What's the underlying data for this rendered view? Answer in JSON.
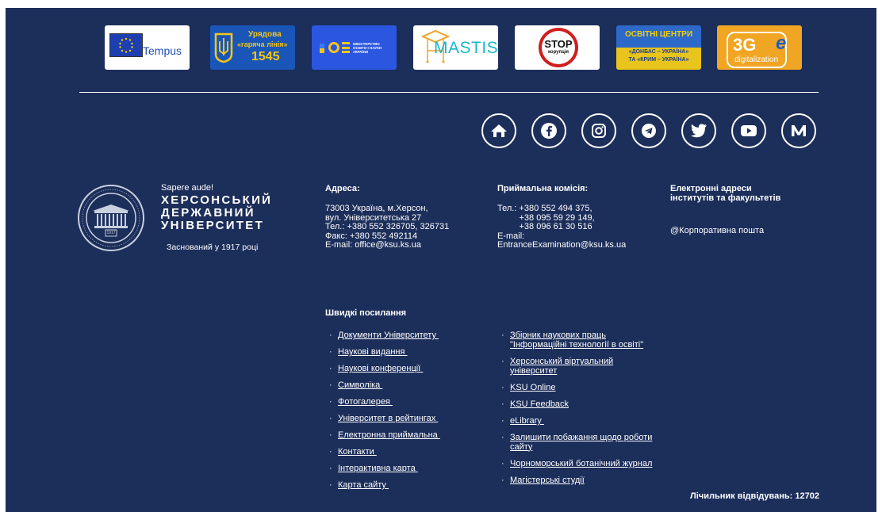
{
  "partners": [
    {
      "name": "tempus-logo",
      "text": "Tempus"
    },
    {
      "name": "hotline-logo",
      "line1": "Урядова",
      "line2": "«гаряча лінія»",
      "line3": "1545"
    },
    {
      "name": "ministry-logo",
      "text": "МІНІСТЕРСТВО ОСВІТИ І НАУКИ УКРАЇНИ"
    },
    {
      "name": "mastis-logo",
      "text": "MASTIS"
    },
    {
      "name": "stop-corruption-logo",
      "text": "STOP",
      "sub": "корупція"
    },
    {
      "name": "education-centers-logo",
      "line1": "ОСВІТНІ ЦЕНТРИ",
      "line2": "«ДОНБАС – УКРАЇНА»",
      "line3": "ТА «КРИМ – УКРАЇНА»"
    },
    {
      "name": "3g-digitalization-logo",
      "big": "3G",
      "small": "digitalization",
      "letter": "e"
    }
  ],
  "socials": [
    "home-icon",
    "facebook-icon",
    "instagram-icon",
    "telegram-icon",
    "twitter-icon",
    "youtube-icon",
    "medium-icon"
  ],
  "brand": {
    "motto": "Sapere aude!",
    "name_lines": [
      "ХЕРСОНСЬКИЙ",
      "ДЕРЖАВНИЙ",
      "УНІВЕРСИТЕТ"
    ],
    "founded": "Заснований у 1917 році",
    "seal_text": "1917"
  },
  "address": {
    "title": "Адреса:",
    "text": "73003 Україна, м.Херсон,\nвул. Університетська 27\nТел.: +380 552 326705, 326731\nФакс: +380 552 492114\nE-mail: office@ksu.ks.ua"
  },
  "admission": {
    "title": "Приймальна комісія:",
    "text": "Тел.: +380 552 494 375,\n         +38 095 59 29 149,\n         +38 096 61 30 516\nE-mail:\nEntranceExamination@ksu.ks.ua"
  },
  "emails": {
    "title_lines": [
      "Електронні адреси",
      "інститутів та факультетів"
    ],
    "link": "@Корпоративна пошта"
  },
  "quick": {
    "title": "Швидкі посилання",
    "left": [
      "Документи Університету ",
      "Наукові видання ",
      "Наукові конференції ",
      "Символіка ",
      "Фотогалерея ",
      "Університет в рейтингах ",
      "Електронна приймальна ",
      "Контакти ",
      "Інтерактивна карта ",
      "Карта сайту "
    ],
    "right": [
      "Збірник наукових праць\n\"Інформаційні технології в освіті\"",
      "Херсонський віртуальний\nуніверситет",
      "KSU Online",
      "KSU Feedback",
      "eLibrary ",
      "Залишити побажання щодо роботи\nсайту",
      "Чорноморський ботанічний журнал",
      "Магістерські студії"
    ]
  },
  "counter": "Лічильник відвідувань: 12702",
  "colors": {
    "footer_bg": "#1c2e5a",
    "hotline_bg": "#1a56b7",
    "ministry_bg": "#2b56e0",
    "edu_bg": "#2d69c8",
    "g3_bg": "#f0a523"
  }
}
